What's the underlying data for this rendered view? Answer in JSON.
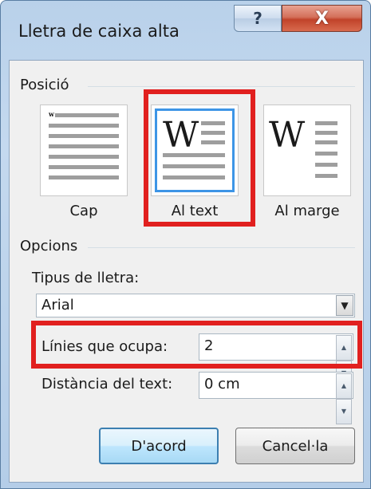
{
  "window": {
    "title": "Lletra de caixa alta",
    "help_label": "?",
    "close_label": "X"
  },
  "position": {
    "group_label": "Posició",
    "options": [
      {
        "label": "Cap",
        "underline_char": "p",
        "selected": false
      },
      {
        "label": "Al text",
        "underline_char": "A",
        "selected": true
      },
      {
        "label": "Al marge",
        "underline_char": "m",
        "selected": false
      }
    ],
    "tile_glyph": "W",
    "small_glyph": "w"
  },
  "options": {
    "group_label": "Opcions",
    "font_label": "Tipus de lletra:",
    "font_value": "Arial",
    "lines_label": "Línies que ocupa:",
    "lines_value": "2",
    "distance_label": "Distància del text:",
    "distance_value": "0 cm"
  },
  "buttons": {
    "ok": "D'acord",
    "cancel": "Cancel·la"
  },
  "colors": {
    "highlight": "#e1201f",
    "selection": "#3d95e6"
  }
}
